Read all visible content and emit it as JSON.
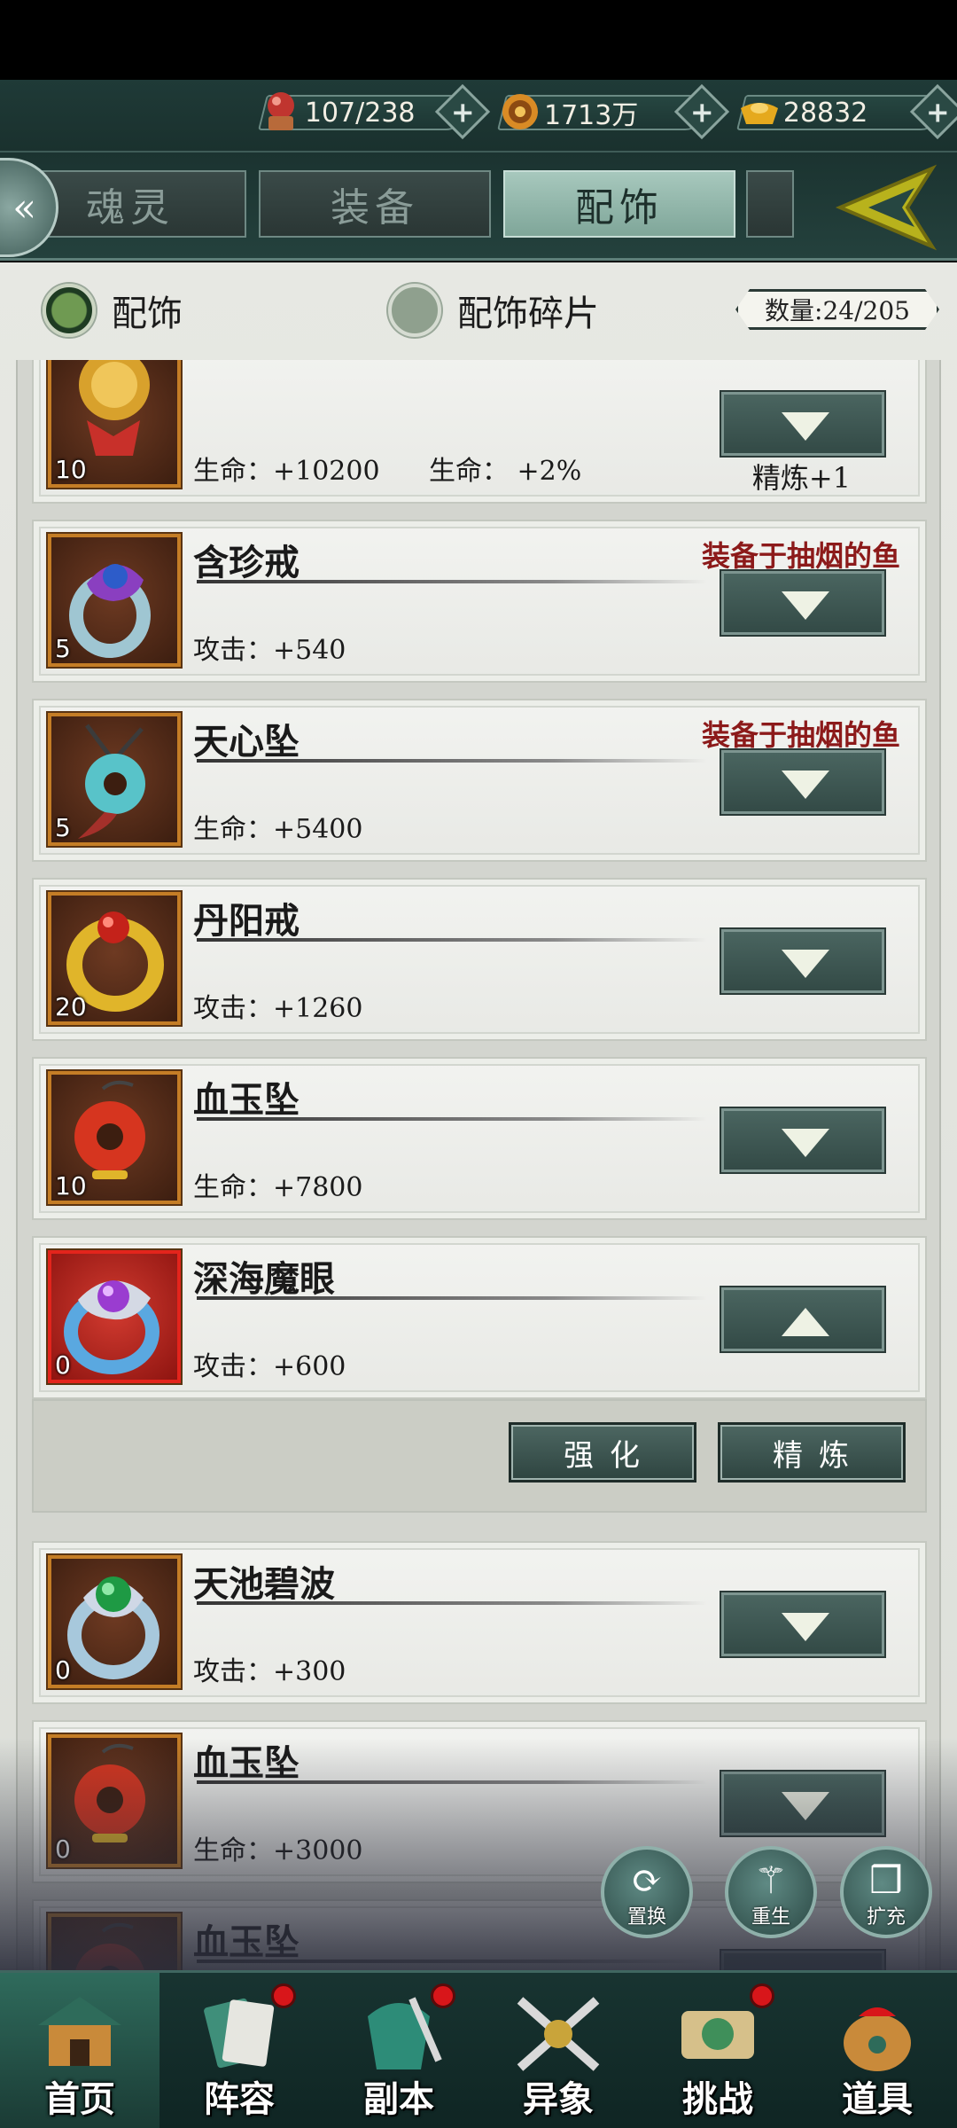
{
  "resources": [
    {
      "icon": "stamina-orb-icon",
      "value": "107/238"
    },
    {
      "icon": "coin-icon",
      "value": "1713万"
    },
    {
      "icon": "gold-ingot-icon",
      "value": "28832"
    }
  ],
  "tabs": [
    {
      "label": "魂灵",
      "active": false
    },
    {
      "label": "装备",
      "active": false
    },
    {
      "label": "配饰",
      "active": true
    }
  ],
  "filters": {
    "accessories": "配饰",
    "fragments": "配饰碎片",
    "count": "数量:24/205"
  },
  "items": [
    {
      "name": "",
      "level": "10",
      "stat": "生命：+10200",
      "stat2": "生命：  +2%",
      "refine": "精炼+1",
      "equipped": "",
      "expanded": false,
      "icon": "bell-icon"
    },
    {
      "name": "含珍戒",
      "level": "5",
      "stat": "攻击：+540",
      "equipped": "装备于抽烟的鱼",
      "expanded": false,
      "icon": "ring-purple-icon"
    },
    {
      "name": "天心坠",
      "level": "5",
      "stat": "生命：+5400",
      "equipped": "装备于抽烟的鱼",
      "expanded": false,
      "icon": "jade-pendant-icon"
    },
    {
      "name": "丹阳戒",
      "level": "20",
      "stat": "攻击：+1260",
      "equipped": "",
      "expanded": false,
      "icon": "ring-gold-icon"
    },
    {
      "name": "血玉坠",
      "level": "10",
      "stat": "生命：+7800",
      "equipped": "",
      "expanded": false,
      "icon": "red-pendant-icon"
    },
    {
      "name": "深海魔眼",
      "level": "0",
      "stat": "攻击：+600",
      "equipped": "",
      "expanded": true,
      "icon": "ring-silver-icon"
    },
    {
      "name": "天池碧波",
      "level": "0",
      "stat": "攻击：+300",
      "equipped": "",
      "expanded": false,
      "icon": "ring-green-icon"
    },
    {
      "name": "血玉坠",
      "level": "0",
      "stat": "生命：+3000",
      "equipped": "",
      "expanded": false,
      "icon": "red-pendant-icon"
    },
    {
      "name": "血玉坠",
      "level": "",
      "stat": "",
      "equipped": "",
      "expanded": false,
      "icon": "red-pendant-icon"
    }
  ],
  "actions": {
    "enhance": "强化",
    "refine": "精炼"
  },
  "float_buttons": [
    {
      "label": "置换",
      "icon": "swap-icon"
    },
    {
      "label": "重生",
      "icon": "rebirth-icon"
    },
    {
      "label": "扩充",
      "icon": "bag-icon"
    }
  ],
  "nav": [
    {
      "label": "首页",
      "badge": false,
      "active": true
    },
    {
      "label": "阵容",
      "badge": true,
      "active": false
    },
    {
      "label": "副本",
      "badge": true,
      "active": false
    },
    {
      "label": "异象",
      "badge": false,
      "active": false
    },
    {
      "label": "挑战",
      "badge": true,
      "active": false
    },
    {
      "label": "道具",
      "badge": false,
      "active": false
    }
  ]
}
